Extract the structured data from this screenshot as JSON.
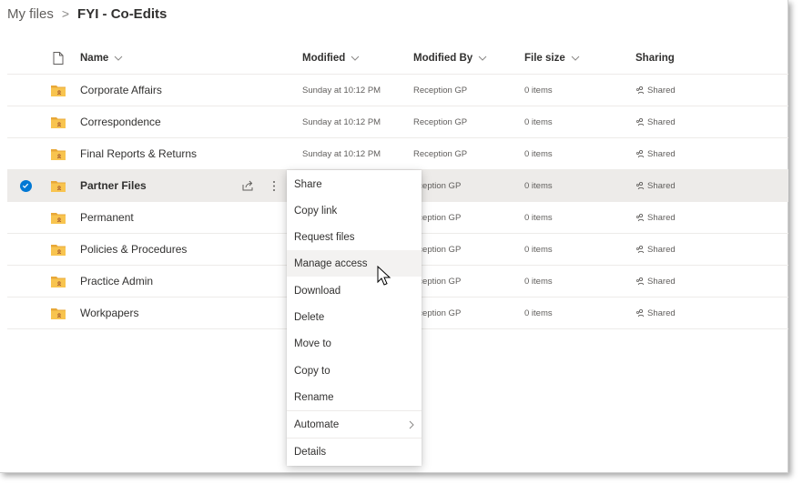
{
  "breadcrumb": {
    "root": "My files",
    "separator": ">",
    "current": "FYI - Co-Edits"
  },
  "columns": {
    "type_icon": "document-icon",
    "name": "Name",
    "modified": "Modified",
    "modified_by": "Modified By",
    "file_size": "File size",
    "sharing": "Sharing"
  },
  "rows": [
    {
      "name": "Corporate Affairs",
      "modified": "Sunday at 10:12 PM",
      "modified_by": "Reception GP",
      "file_size": "0 items",
      "sharing": "Shared"
    },
    {
      "name": "Correspondence",
      "modified": "Sunday at 10:12 PM",
      "modified_by": "Reception GP",
      "file_size": "0 items",
      "sharing": "Shared"
    },
    {
      "name": "Final Reports & Returns",
      "modified": "Sunday at 10:12 PM",
      "modified_by": "Reception GP",
      "file_size": "0 items",
      "sharing": "Shared"
    },
    {
      "name": "Partner Files",
      "modified": "",
      "modified_by": "eception GP",
      "file_size": "0 items",
      "sharing": "Shared",
      "selected": true
    },
    {
      "name": "Permanent",
      "modified": "",
      "modified_by": "eception GP",
      "file_size": "0 items",
      "sharing": "Shared"
    },
    {
      "name": "Policies & Procedures",
      "modified": "",
      "modified_by": "eception GP",
      "file_size": "0 items",
      "sharing": "Shared"
    },
    {
      "name": "Practice Admin",
      "modified": "",
      "modified_by": "eception GP",
      "file_size": "0 items",
      "sharing": "Shared"
    },
    {
      "name": "Workpapers",
      "modified": "",
      "modified_by": "eception GP",
      "file_size": "0 items",
      "sharing": "Shared"
    }
  ],
  "context_menu": {
    "items": [
      {
        "label": "Share"
      },
      {
        "label": "Copy link"
      },
      {
        "label": "Request files"
      },
      {
        "label": "Manage access",
        "hovered": true
      },
      {
        "label": "Download"
      },
      {
        "label": "Delete"
      },
      {
        "label": "Move to"
      },
      {
        "label": "Copy to"
      },
      {
        "label": "Rename"
      },
      {
        "label": "Automate",
        "has_submenu": true
      },
      {
        "label": "Details"
      }
    ]
  },
  "colors": {
    "folder": "#f8c44f",
    "folder_dark": "#e8a838",
    "accent": "#0078d4",
    "selected_row": "#edebe9"
  }
}
